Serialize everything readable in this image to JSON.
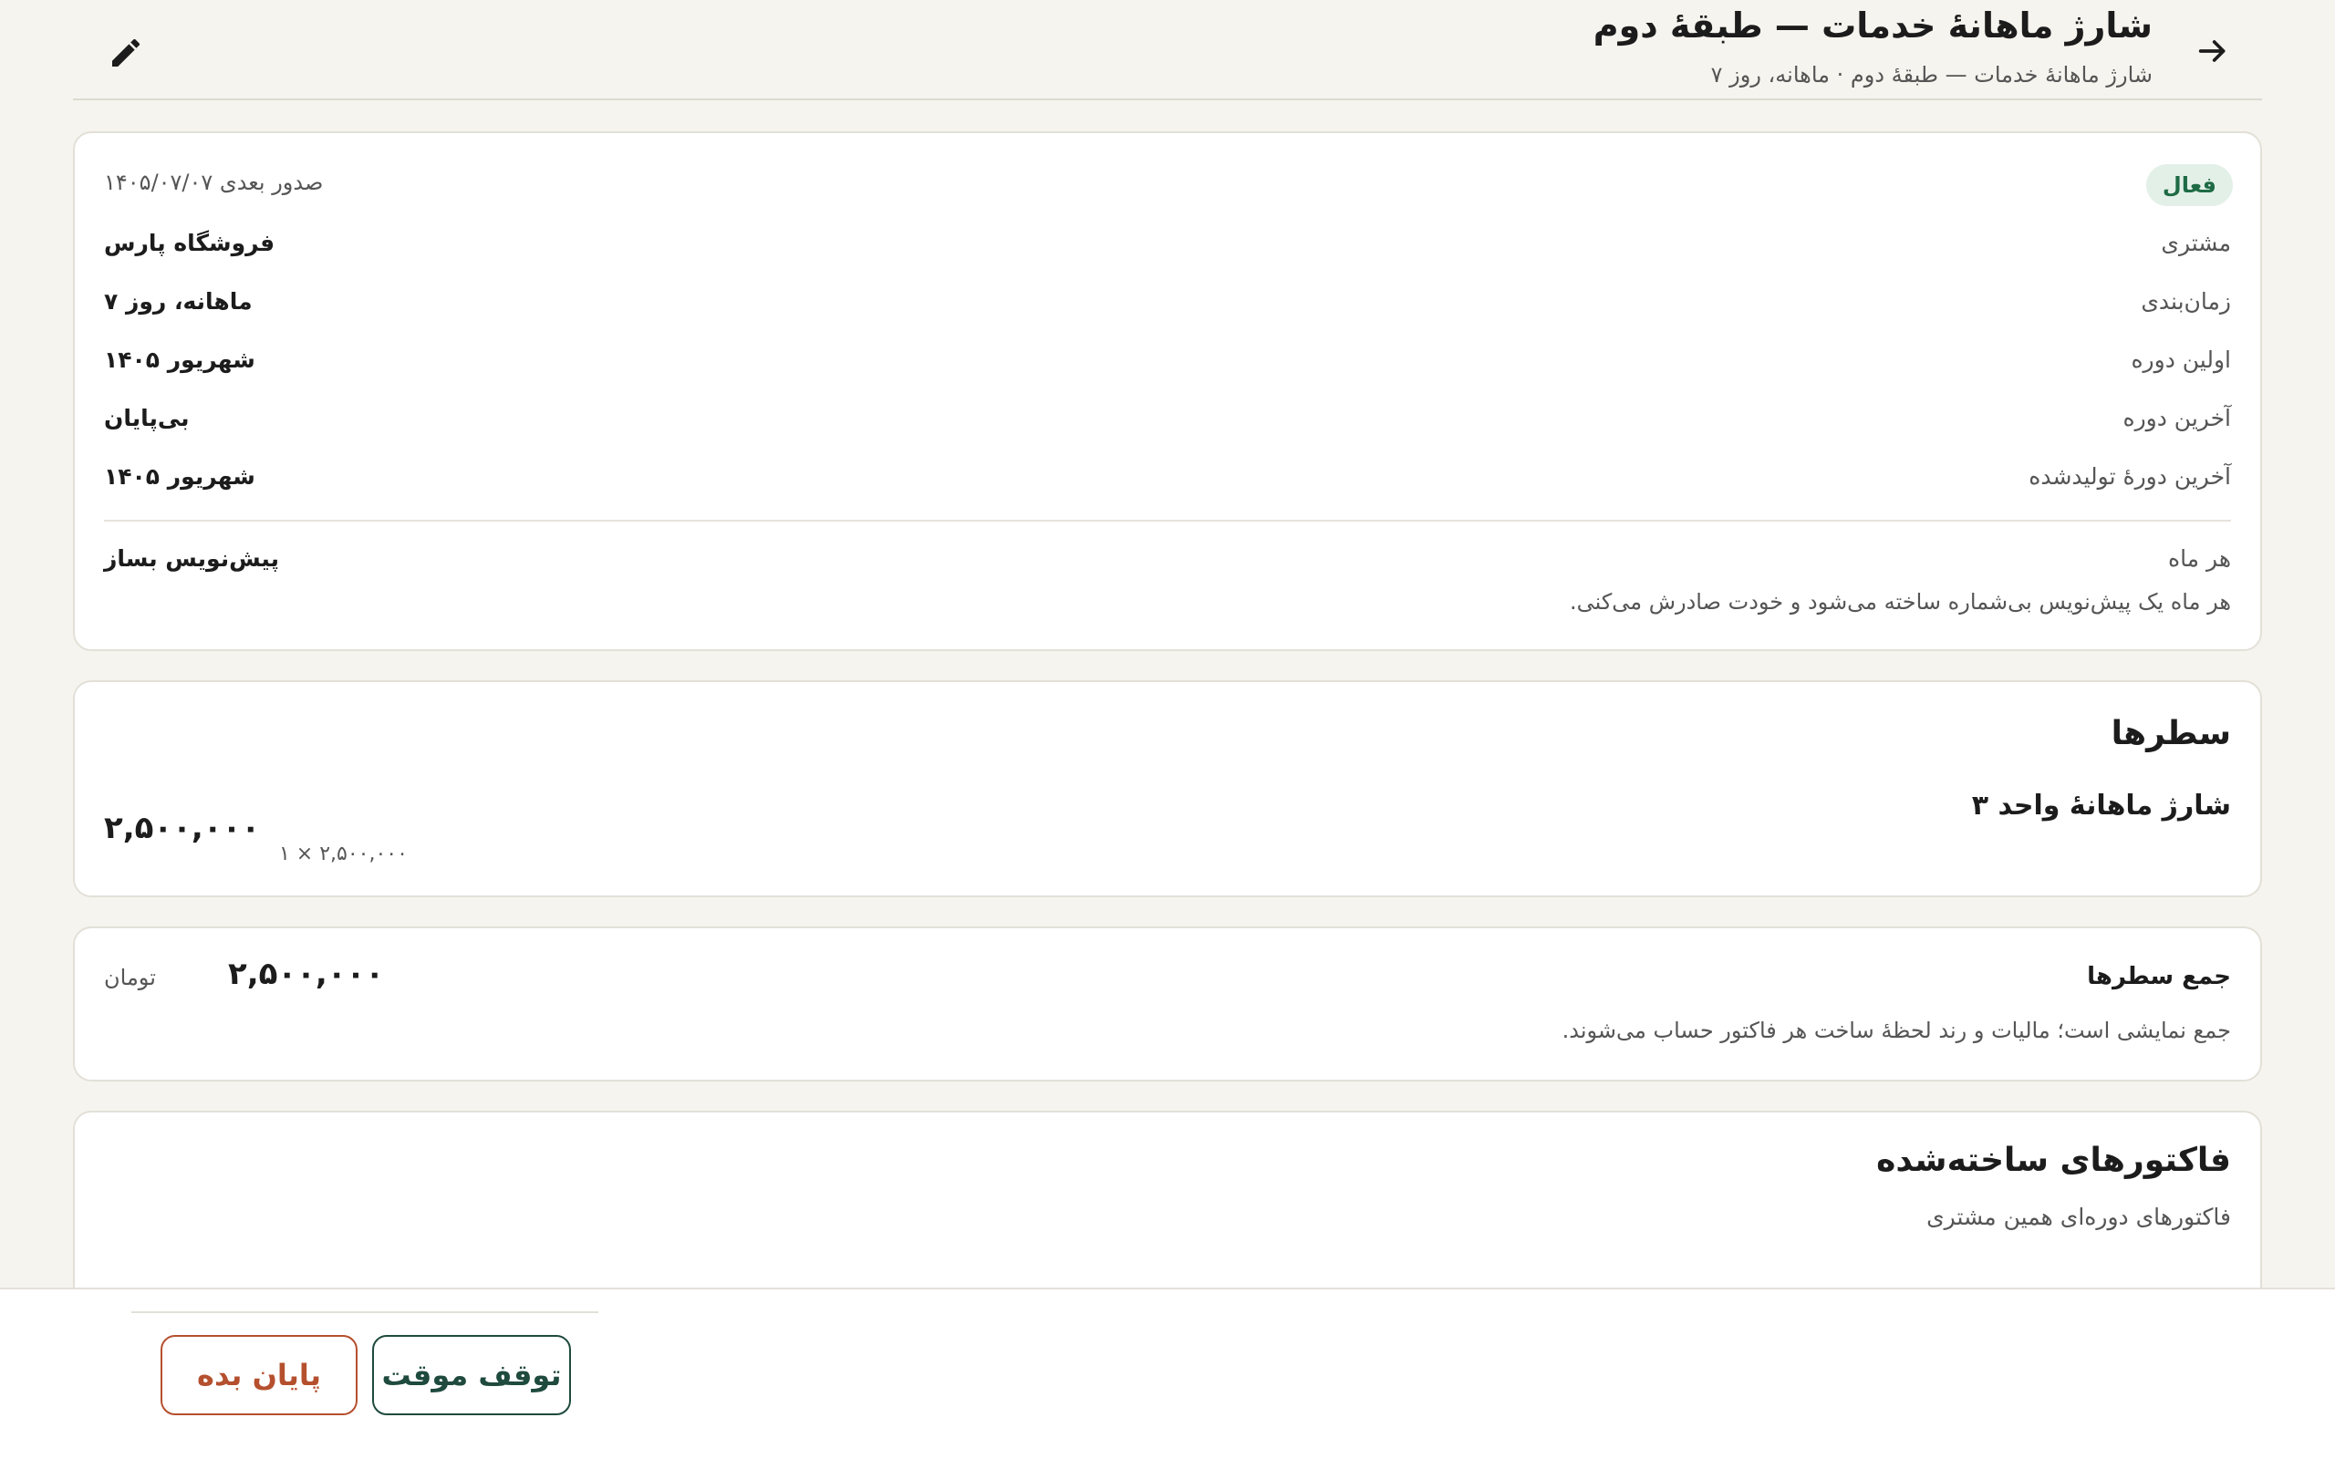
{
  "header": {
    "title": "شارژ ماهانهٔ خدمات — طبقهٔ دوم",
    "subtitle": "شارژ ماهانهٔ خدمات — طبقهٔ دوم · ماهانه، روز ۷",
    "back_icon": "arrow-right-icon",
    "edit_icon": "pencil-icon"
  },
  "summary": {
    "status_badge": "فعال",
    "status_color": "#1f6b45",
    "next_issue": "صدور بعدی ۱۴۰۵/۰۷/۰۷",
    "rows": [
      {
        "label": "مشتری",
        "value": "فروشگاه پارس"
      },
      {
        "label": "زمان‌بندی",
        "value": "ماهانه، روز ۷"
      },
      {
        "label": "اولین دوره",
        "value": "شهریور ۱۴۰۵"
      },
      {
        "label": "آخرین دوره",
        "value": "بی‌پایان"
      },
      {
        "label": "آخرین دورهٔ تولیدشده",
        "value": "شهریور ۱۴۰۵"
      }
    ],
    "mode_label": "هر ماه",
    "mode_value": "پیش‌نویس بساز",
    "mode_hint": "هر ماه یک پیش‌نویس بی‌شماره ساخته می‌شود و خودت صادرش می‌کنی."
  },
  "lines": {
    "title": "سطرها",
    "items": [
      {
        "name": "شارژ ماهانهٔ واحد ۳",
        "amount": "۲,۵۰۰,۰۰۰",
        "detail": "۱ × ۲,۵۰۰,۰۰۰"
      }
    ]
  },
  "total": {
    "label": "جمع سطرها",
    "amount": "۲,۵۰۰,۰۰۰",
    "currency": "تومان",
    "note": "جمع نمایشی است؛ مالیات و رند لحظهٔ ساخت هر فاکتور حساب می‌شوند."
  },
  "invoices": {
    "title": "فاکتورهای ساخته‌شده",
    "subtitle": "فاکتورهای دوره‌ای همین مشتری"
  },
  "actions": {
    "pause_label": "توقف موقت",
    "end_label": "پایان بده",
    "pause_color": "#1f4a3e",
    "end_color": "#b5502e"
  }
}
